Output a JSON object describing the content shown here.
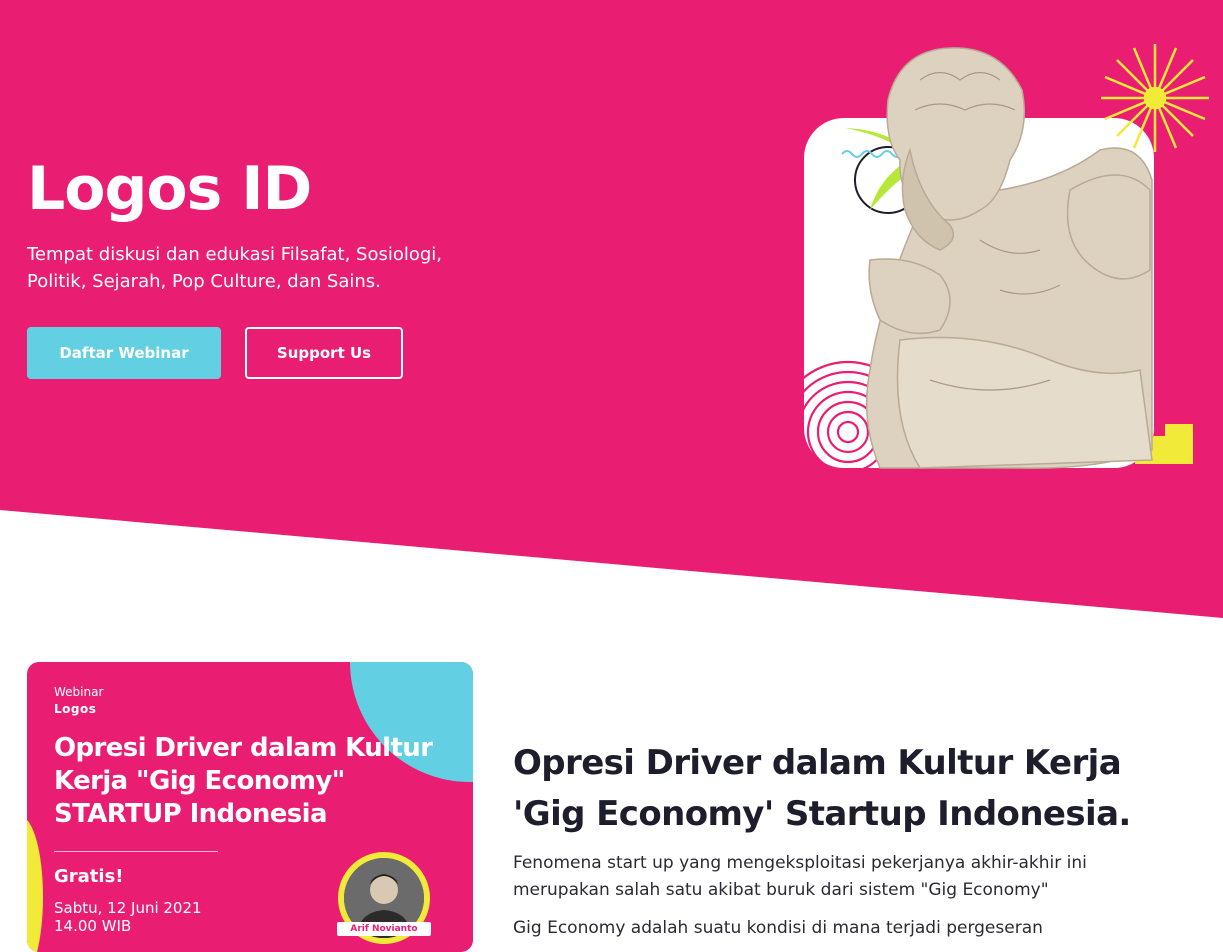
{
  "colors": {
    "brand_pink": "#e91e73",
    "accent_blue": "#63cfe3",
    "accent_yellow": "#f2ea38",
    "text_dark": "#1d1d2b"
  },
  "hero": {
    "title": "Logos ID",
    "subtitle": "Tempat diskusi dan edukasi Filsafat, Sosiologi, Politik, Sejarah, Pop Culture, dan Sains.",
    "primary_button": "Daftar Webinar",
    "secondary_button": "Support Us",
    "image_icon": "thinker-statue-illustration"
  },
  "poster": {
    "label": "Webinar",
    "logo_text": "Logos",
    "title": "Opresi Driver dalam Kultur Kerja \"Gig Economy\" STARTUP Indonesia",
    "free_label": "Gratis!",
    "date": "Sabtu, 12 Juni 2021",
    "time": "14.00 WIB",
    "speaker_name": "Arif Novianto"
  },
  "article": {
    "title": "Opresi Driver dalam Kultur Kerja 'Gig Economy' Startup Indonesia.",
    "paragraph_1": "Fenomena start up yang mengeksploitasi pekerjanya akhir-akhir ini merupakan salah satu akibat buruk dari sistem \"Gig Economy\"",
    "paragraph_2": "Gig Economy adalah suatu kondisi di mana terjadi pergeseran"
  }
}
